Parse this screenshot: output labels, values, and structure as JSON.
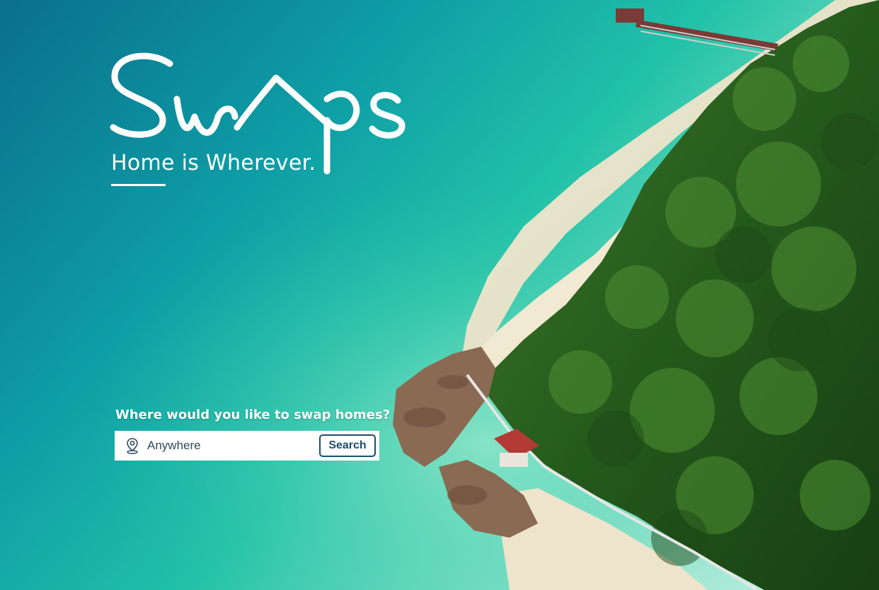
{
  "brand": {
    "name": "Swaps",
    "tagline": "Home is Wherever."
  },
  "search": {
    "prompt": "Where would you like to swap homes?",
    "placeholder": "Anywhere",
    "value": "",
    "button_label": "Search",
    "icon": "location-pin-icon"
  },
  "colors": {
    "accent": "#1f4d6b",
    "text_on_hero": "#ffffff",
    "field_text": "#2d4a5c"
  }
}
